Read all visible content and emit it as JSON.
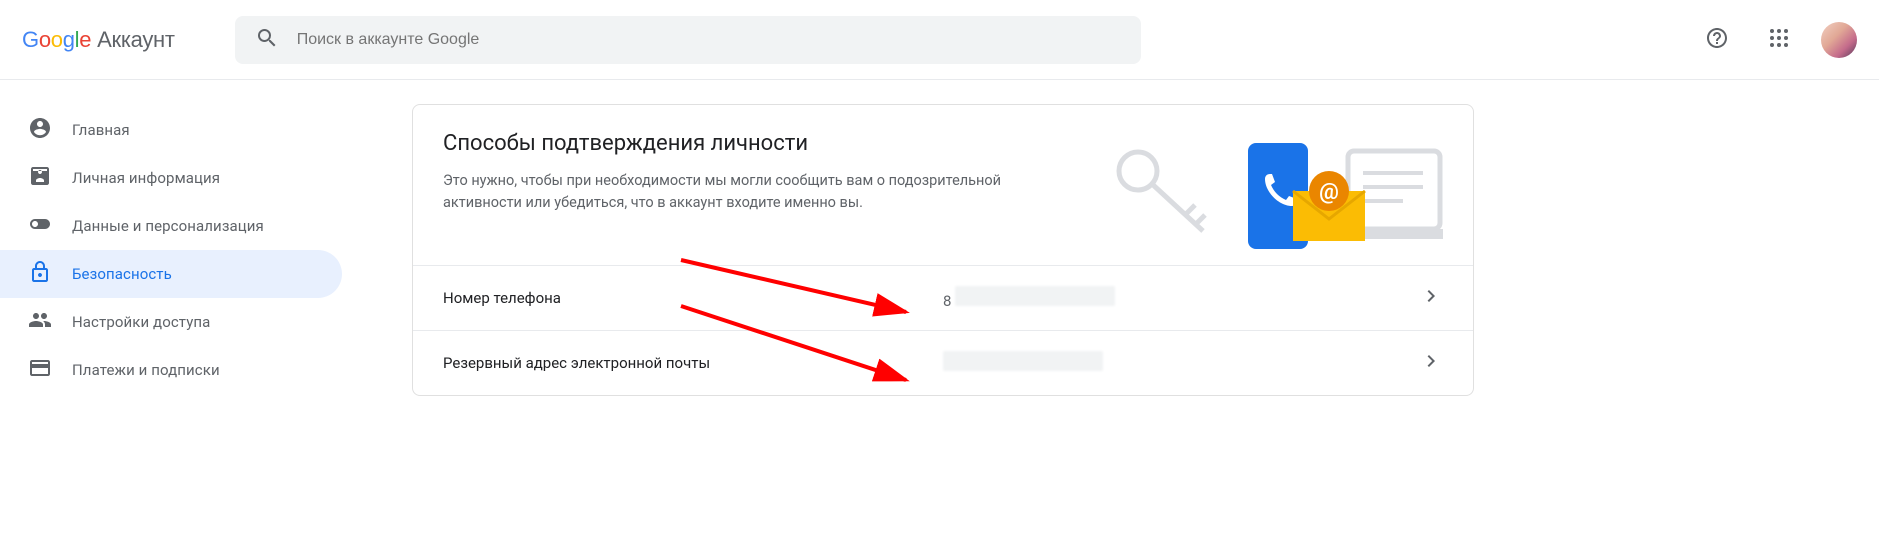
{
  "header": {
    "logo_brand": "Google",
    "logo_product": "Аккаунт",
    "search_placeholder": "Поиск в аккаунте Google"
  },
  "sidebar": {
    "items": [
      {
        "id": "home",
        "label": "Главная",
        "active": false
      },
      {
        "id": "personal",
        "label": "Личная информация",
        "active": false
      },
      {
        "id": "data",
        "label": "Данные и персонализация",
        "active": false
      },
      {
        "id": "security",
        "label": "Безопасность",
        "active": true
      },
      {
        "id": "sharing",
        "label": "Настройки доступа",
        "active": false
      },
      {
        "id": "payments",
        "label": "Платежи и подписки",
        "active": false
      }
    ]
  },
  "card": {
    "title": "Способы подтверждения личности",
    "description": "Это нужно, чтобы при необходимости мы могли сообщить вам о подозрительной активности или убедиться, что в аккаунт входите именно вы.",
    "rows": [
      {
        "label": "Номер телефона",
        "value": "8"
      },
      {
        "label": "Резервный адрес электронной почты",
        "value": ""
      }
    ]
  },
  "colors": {
    "accent": "#1a73e8",
    "arrow": "#ff0000"
  }
}
